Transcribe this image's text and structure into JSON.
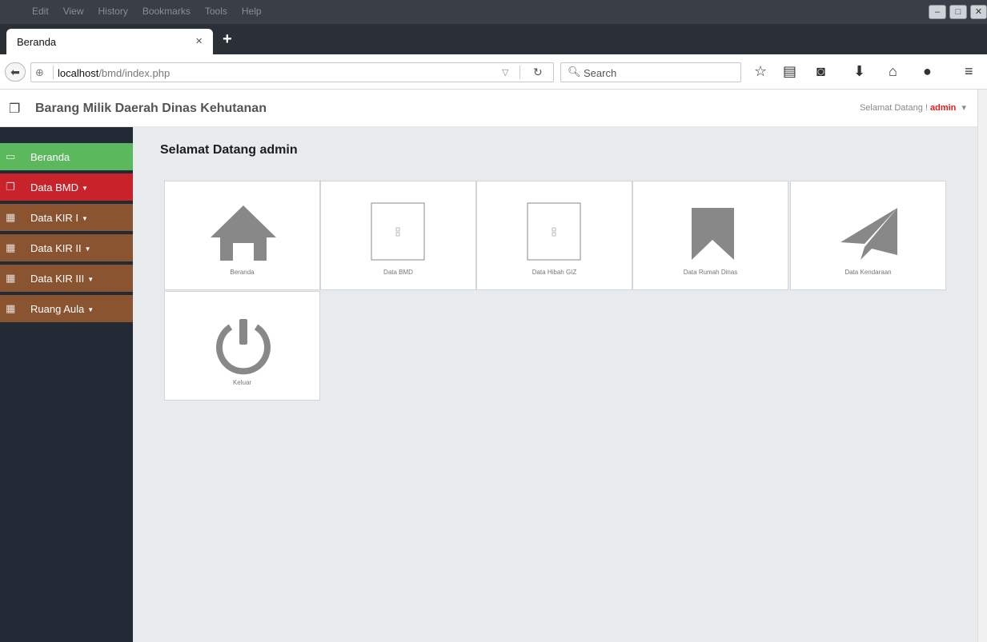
{
  "browser": {
    "menu_items": [
      "Edit",
      "View",
      "History",
      "Bookmarks",
      "Tools",
      "Help"
    ],
    "tab_title": "Beranda",
    "tab_close": "×",
    "new_tab": "+",
    "url_host": "localhost",
    "url_path": "/bmd/index.php",
    "search_placeholder": "Search"
  },
  "header": {
    "title": "Barang Milik Daerah Dinas Kehutanan",
    "welcome_text": "Selamat Datang !",
    "username": "admin"
  },
  "sidebar": {
    "items": [
      {
        "label": "Beranda",
        "color": "#5cb85c",
        "has_caret": false
      },
      {
        "label": "Data BMD",
        "color": "#c8232a",
        "has_caret": true
      },
      {
        "label": "Data KIR I",
        "color": "#8a5431",
        "has_caret": true
      },
      {
        "label": "Data KIR II",
        "color": "#8a5431",
        "has_caret": true
      },
      {
        "label": "Data KIR III",
        "color": "#8a5431",
        "has_caret": true
      },
      {
        "label": "Ruang Aula",
        "color": "#8a5431",
        "has_caret": true
      }
    ]
  },
  "main": {
    "page_title": "Selamat Datang admin",
    "tiles": [
      {
        "label": "Beranda",
        "icon": "home-icon"
      },
      {
        "label": "Data BMD",
        "icon": "broken-image-icon"
      },
      {
        "label": "Data Hibah GIZ",
        "icon": "broken-image-icon"
      },
      {
        "label": "Data Rumah Dinas",
        "icon": "bookmark-icon"
      },
      {
        "label": "Data Kendaraan",
        "icon": "paper-plane-icon"
      },
      {
        "label": "Keluar",
        "icon": "power-icon"
      }
    ]
  },
  "colors": {
    "sidebar_bg": "#222a36",
    "main_bg": "#e8ebee",
    "icon_gray": "#888888",
    "username_red": "#e41c1c"
  }
}
